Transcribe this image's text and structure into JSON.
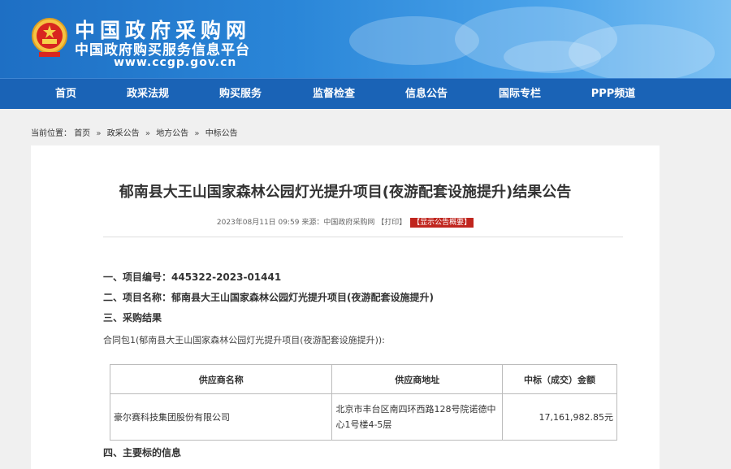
{
  "header": {
    "site_name": "中国政府采购网",
    "site_full_name": "中国政府购买服务信息平台",
    "url": "www.ccgp.gov.cn",
    "brand_color": "#1a63b6"
  },
  "nav": {
    "items": [
      "首页",
      "政采法规",
      "购买服务",
      "监督检查",
      "信息公告",
      "国际专栏",
      "PPP频道"
    ]
  },
  "breadcrumb": {
    "prefix": "当前位置：",
    "items": [
      "首页",
      "政采公告",
      "地方公告",
      "中标公告"
    ],
    "separator": "»"
  },
  "article": {
    "title": "郁南县大王山国家森林公园灯光提升项目(夜游配套设施提升)结果公告",
    "meta": "2023年08月11日 09:59 来源：中国政府采购网",
    "print_label": "【打印】",
    "summary_label": "【显示公告概要】",
    "section1": "一、项目编号：445322-2023-01441",
    "section2": "二、项目名称：郁南县大王山国家森林公园灯光提升项目(夜游配套设施提升)",
    "section3": "三、采购结果",
    "contract_pkg": "合同包1(郁南县大王山国家森林公园灯光提升项目(夜游配套设施提升)):",
    "table": {
      "headers": [
        "供应商名称",
        "供应商地址",
        "中标（成交）金额"
      ],
      "rows": [
        {
          "supplier": "豪尔赛科技集团股份有限公司",
          "address_line1": "北京市丰台区南四环西路128号院诺德中",
          "address_line2": "心1号楼4-5层",
          "amount": "17,161,982.85元"
        }
      ]
    },
    "section4": "四、主要标的信息"
  }
}
